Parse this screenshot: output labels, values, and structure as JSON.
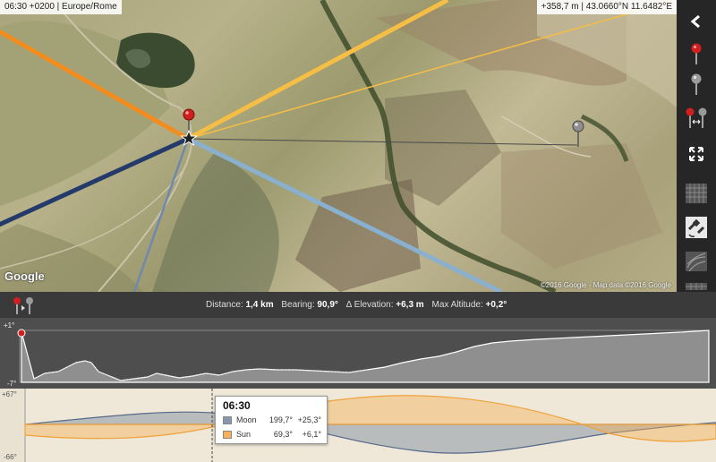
{
  "map": {
    "info_left": "06:30 +0200 | Europe/Rome",
    "info_right": "+358,7 m | 43.0660°N 11.6482°E",
    "google_logo": "Google",
    "attribution": "©2016 Google - Map data ©2016 Google"
  },
  "toolbar": {
    "items": [
      {
        "name": "collapse-chevron-icon"
      },
      {
        "name": "red-pin-icon"
      },
      {
        "name": "grey-pin-icon"
      },
      {
        "name": "pin-pair-icon"
      },
      {
        "name": "expand-icon"
      },
      {
        "name": "layer-grid-icon"
      },
      {
        "name": "satellite-layer-icon"
      },
      {
        "name": "terrain-layer-icon"
      },
      {
        "name": "layer-more-icon"
      }
    ]
  },
  "stats": {
    "distance_label": "Distance:",
    "distance_value": "1,4 km",
    "bearing_label": "Bearing:",
    "bearing_value": "90,9°",
    "elevation_label": "Δ Elevation:",
    "elevation_value": "+6,3 m",
    "max_altitude_label": "Max Altitude:",
    "max_altitude_value": "+0,2°"
  },
  "profile": {
    "y_top_label": "+1°",
    "y_bottom_label": "-7°"
  },
  "sunmoon": {
    "y_top_label": "+67°",
    "y_bottom_label": "-66°",
    "tooltip": {
      "time": "06:30",
      "rows": [
        {
          "name": "Moon",
          "azimuth": "199,7°",
          "elevation": "+25,3°",
          "color": "#8797ad"
        },
        {
          "name": "Sun",
          "azimuth": "69,3°",
          "elevation": "+6,1°",
          "color": "#f3b25a"
        }
      ]
    }
  },
  "colors": {
    "sunrise_line": "#f28c1e",
    "sun_line": "#f6be45",
    "moonset_line": "#233a6a",
    "moon_line": "#8ab0d0",
    "sight_line": "#4a4a4a",
    "sun_curve": "#f0a23a",
    "moon_curve": "#55698a"
  }
}
